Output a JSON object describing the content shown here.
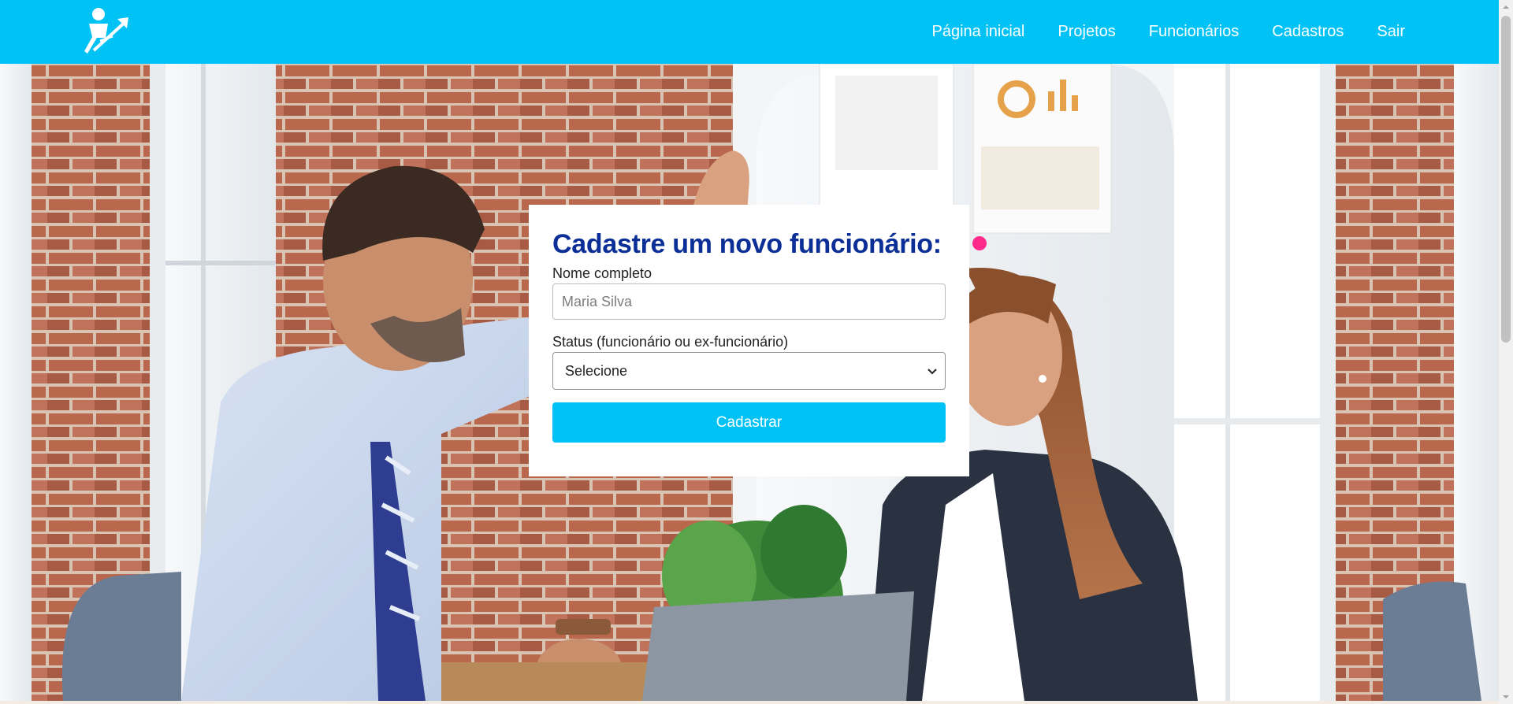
{
  "navbar": {
    "logo_icon": "person-growth-arrow-icon",
    "links": [
      "Página inicial",
      "Projetos",
      "Funcionários",
      "Cadastros",
      "Sair"
    ]
  },
  "form": {
    "title": "Cadastre um novo funcionário:",
    "name_label": "Nome completo",
    "name_placeholder": "Maria Silva",
    "status_label": "Status (funcionário ou ex-funcionário)",
    "status_selected": "Selecione",
    "submit_label": "Cadastrar"
  },
  "colors": {
    "navbar_bg": "#00c2f5",
    "title_text": "#0b2e97",
    "button_bg": "#00c2f5"
  }
}
